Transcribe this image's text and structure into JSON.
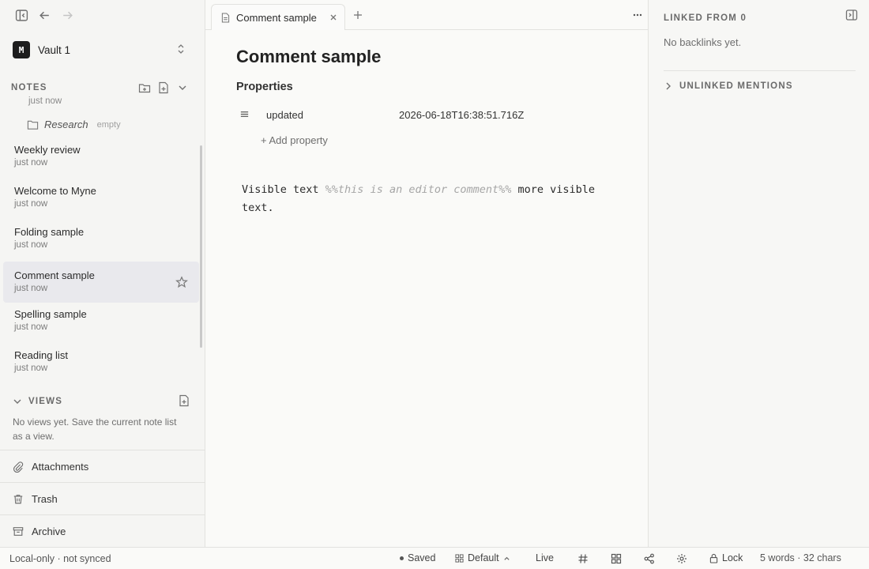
{
  "sidebar": {
    "vault": {
      "logo": "M",
      "name": "Vault 1"
    },
    "notes_section": {
      "label": "NOTES"
    },
    "partial_item_time": "just now",
    "folder": {
      "name": "Research",
      "badge": "empty"
    },
    "notes": [
      {
        "title": "Weekly review",
        "time": "just now"
      },
      {
        "title": "Welcome to Myne",
        "time": "just now"
      },
      {
        "title": "Folding sample",
        "time": "just now"
      },
      {
        "title": "Comment sample",
        "time": "just now"
      },
      {
        "title": "Spelling sample",
        "time": "just now"
      },
      {
        "title": "Reading list",
        "time": "just now"
      }
    ],
    "views": {
      "label": "VIEWS",
      "empty_text": "No views yet. Save the current note list as a view."
    },
    "bottom": [
      {
        "label": "Attachments",
        "icon": "paperclip-icon"
      },
      {
        "label": "Trash",
        "icon": "trash-icon"
      },
      {
        "label": "Archive",
        "icon": "archive-icon"
      }
    ]
  },
  "tabs": [
    {
      "title": "Comment sample"
    }
  ],
  "editor": {
    "title": "Comment sample",
    "properties_heading": "Properties",
    "properties": [
      {
        "key": "updated",
        "value": "2026-06-18T16:38:51.716Z"
      }
    ],
    "add_property": "+ Add property",
    "body": {
      "text_before": "Visible text ",
      "comment": "%%this is an editor comment%%",
      "text_after": " more visible text."
    }
  },
  "right_panel": {
    "linked_from": "LINKED FROM 0",
    "no_backlinks": "No backlinks yet.",
    "unlinked_mentions": "UNLINKED MENTIONS"
  },
  "statusbar": {
    "sync": "Local-only · not synced",
    "saved": "Saved",
    "layout": "Default",
    "mode": "Live",
    "lock": "Lock",
    "counts": "5 words · 32 chars"
  }
}
